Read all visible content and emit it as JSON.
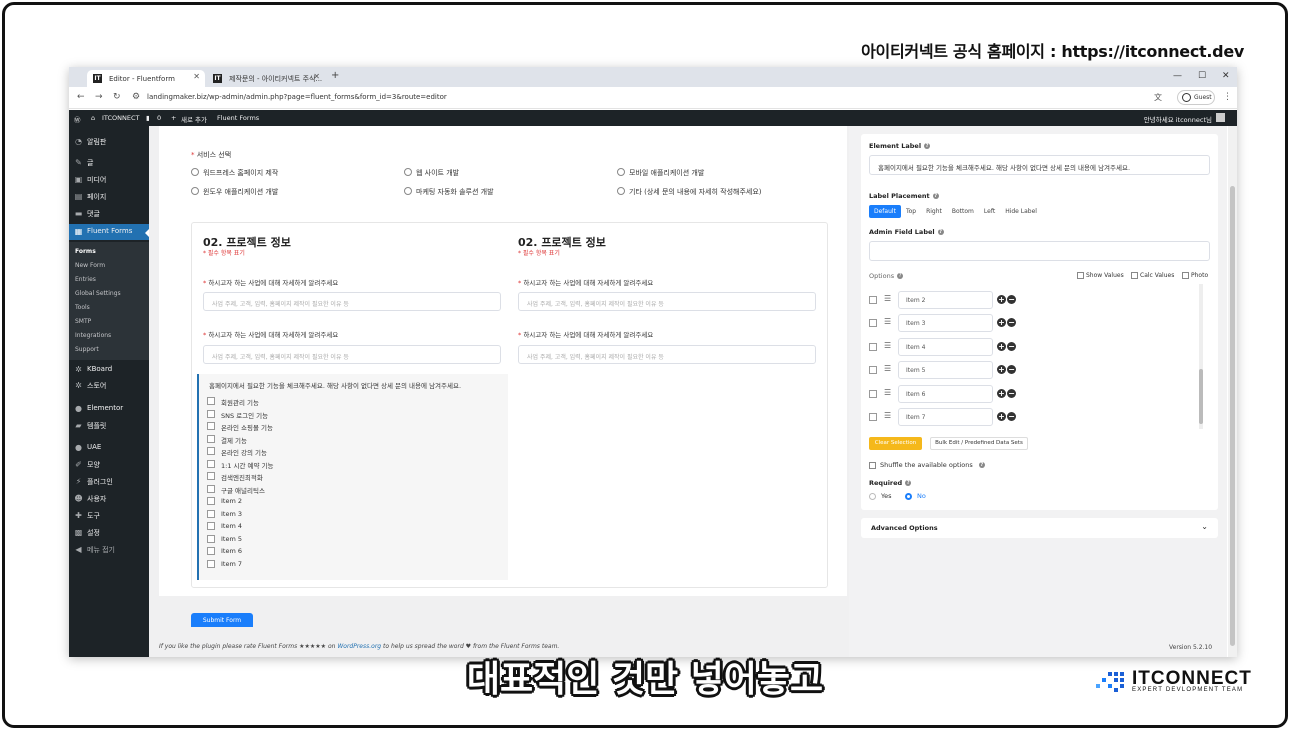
{
  "video": {
    "top_caption": "아이티커넥트 공식 홈페이지 : https://itconnect.dev",
    "subtitle": "대표적인 것만 넣어놓고",
    "logo_title": "ITCONNECT",
    "logo_sub": "EXPERT DEVLOPMENT TEAM"
  },
  "browser": {
    "tabs": [
      {
        "label": "Editor - Fluentform"
      },
      {
        "label": "제작문의 - 아이티커넥트 주식..."
      }
    ],
    "url": "landingmaker.biz/wp-admin/admin.php?page=fluent_forms&form_id=3&route=editor",
    "guest": "Guest"
  },
  "adminbar": {
    "site": "ITCONNECT",
    "comments": "0",
    "new": "새로 추가",
    "plugin": "Fluent Forms",
    "greeting": "안녕하세요 itconnect님"
  },
  "sidebar": {
    "items": [
      {
        "label": "알림판",
        "icon": "dashboard-icon"
      },
      {
        "label": "글",
        "icon": "pin-icon"
      },
      {
        "label": "미디어",
        "icon": "media-icon"
      },
      {
        "label": "페이지",
        "icon": "page-icon"
      },
      {
        "label": "댓글",
        "icon": "comment-icon"
      },
      {
        "label": "Fluent Forms",
        "icon": "form-icon"
      },
      {
        "label": "KBoard",
        "icon": "board-icon"
      },
      {
        "label": "스토어",
        "icon": "store-icon"
      },
      {
        "label": "Elementor",
        "icon": "elementor-icon"
      },
      {
        "label": "템플릿",
        "icon": "template-icon"
      },
      {
        "label": "UAE",
        "icon": "uae-icon"
      },
      {
        "label": "모양",
        "icon": "brush-icon"
      },
      {
        "label": "플러그인",
        "icon": "plugin-icon"
      },
      {
        "label": "사용자",
        "icon": "user-icon"
      },
      {
        "label": "도구",
        "icon": "wrench-icon"
      },
      {
        "label": "설정",
        "icon": "settings-icon"
      },
      {
        "label": "메뉴 접기",
        "icon": "collapse-icon"
      }
    ],
    "sub": [
      "Forms",
      "New Form",
      "Entries",
      "Global Settings",
      "Tools",
      "SMTP",
      "Integrations",
      "Support"
    ]
  },
  "form": {
    "service_label": "서비스 선택",
    "services": [
      "워드프레스 홈페이지 제작",
      "웹 사이트 개발",
      "모바일 애플리케이션 개발",
      "윈도우 애플리케이션 개발",
      "마케팅 자동화 솔루션 개발",
      "기타 (상세 문의 내용에 자세히 작성해주세요)"
    ],
    "section_title": "02. 프로젝트 정보",
    "section_sub": "* 필수 항목 표기",
    "field_label": "하시고자 하는 사업에 대해 자세하게 알려주세요",
    "field_placeholder": "사업 주제, 고객, 입력, 홈페이지 제작이 필요한 이유 등",
    "checkbox_label": "홈페이지에서 필요한 기능을 체크해주세요. 해당 사항이 없다면 상세 문의 내용에 남겨주세요.",
    "checkbox_items": [
      "회원관리 기능",
      "SNS 로그인 기능",
      "온라인 쇼핑몰 기능",
      "결제 기능",
      "온라인 강의 기능",
      "1:1 시간 예약 기능",
      "검색엔진최적화",
      "구글 애널리틱스",
      "Item 2",
      "Item 3",
      "Item 4",
      "Item 5",
      "Item 6",
      "Item 7"
    ],
    "submit": "Submit Form",
    "footer_pre": "If you like the plugin please rate Fluent Forms ★★★★★ on ",
    "footer_link": "WordPress.org",
    "footer_post": " to help us spread the word ♥ from the Fluent Forms team."
  },
  "panel": {
    "element_label_title": "Element Label",
    "element_label_value": "홈페이지에서 필요한 기능을 체크해주세요. 해당 사항이 없다면 상세 문의 내용에 남겨주세요.",
    "placement_title": "Label Placement",
    "placements": [
      "Default",
      "Top",
      "Right",
      "Bottom",
      "Left",
      "Hide Label"
    ],
    "admin_label_title": "Admin Field Label",
    "options_title": "Options",
    "show_values": "Show Values",
    "calc_values": "Calc Values",
    "photo": "Photo",
    "options": [
      "Item 2",
      "Item 3",
      "Item 4",
      "Item 5",
      "Item 6",
      "Item 7"
    ],
    "clear_selection": "Clear Selection",
    "bulk_edit": "Bulk Edit / Predefined Data Sets",
    "shuffle": "Shuffle the available options",
    "required_title": "Required",
    "yes": "Yes",
    "no": "No",
    "advanced": "Advanced Options",
    "version": "Version 5.2.10"
  }
}
